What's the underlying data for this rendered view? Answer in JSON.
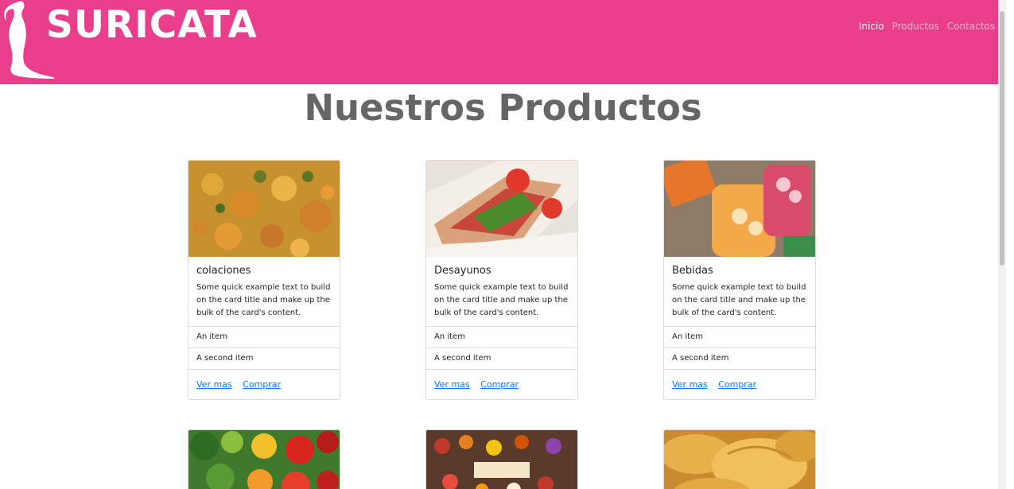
{
  "navbar": {
    "brand": "SURICATA",
    "links": [
      "Inicio",
      "Productos",
      "Contactos"
    ],
    "brand_color": "#e83e8c"
  },
  "page_title": "Nuestros Productos",
  "cards": [
    {
      "title": "colaciones",
      "text": "Some quick example text to build on the card title and make up the bulk of the card's content.",
      "items": [
        "An item",
        "A second item"
      ],
      "links": [
        "Ver mas",
        "Comprar"
      ],
      "image": "food-photo-curry"
    },
    {
      "title": "Desayunos",
      "text": "Some quick example text to build on the card title and make up the bulk of the card's content.",
      "items": [
        "An item",
        "A second item"
      ],
      "links": [
        "Ver mas",
        "Comprar"
      ],
      "image": "food-photo-sandwich"
    },
    {
      "title": "Bebidas",
      "text": "Some quick example text to build on the card title and make up the bulk of the card's content.",
      "items": [
        "An item",
        "A second item"
      ],
      "links": [
        "Ver mas",
        "Comprar"
      ],
      "image": "food-photo-drinks"
    }
  ],
  "second_row_images": [
    "food-photo-vegetables",
    "food-photo-sweets",
    "food-photo-empanadas"
  ]
}
